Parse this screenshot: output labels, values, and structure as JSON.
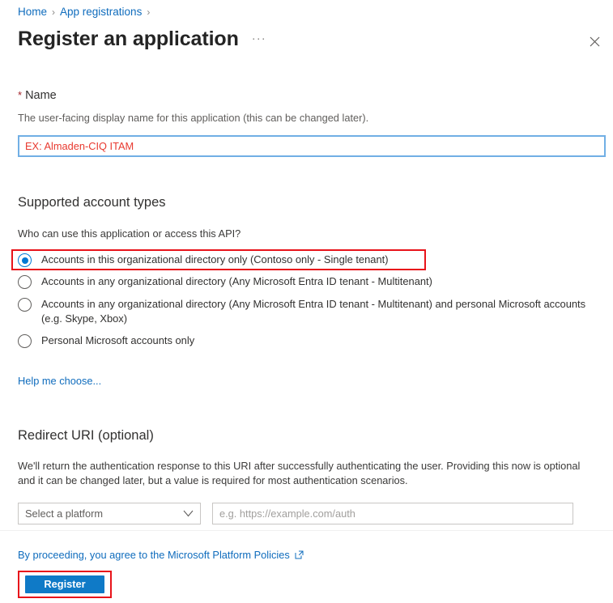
{
  "breadcrumb": {
    "items": [
      {
        "label": "Home"
      },
      {
        "label": "App registrations"
      }
    ],
    "separator": "›"
  },
  "header": {
    "title": "Register an application",
    "more_label": "···",
    "close_icon": "close-icon"
  },
  "name_field": {
    "label": "Name",
    "required_marker": "*",
    "description": "The user-facing display name for this application (this can be changed later).",
    "value": "EX: Almaden-CIQ ITAM",
    "placeholder": "EX: Almaden-CIQ ITAM"
  },
  "supported_account_types": {
    "heading": "Supported account types",
    "question": "Who can use this application or access this API?",
    "options": [
      {
        "label": "Accounts in this organizational directory only (Contoso only - Single tenant)",
        "selected": true,
        "highlighted": true
      },
      {
        "label": "Accounts in any organizational directory (Any Microsoft Entra ID tenant - Multitenant)",
        "selected": false,
        "highlighted": false
      },
      {
        "label": "Accounts in any organizational directory (Any Microsoft Entra ID tenant - Multitenant) and personal Microsoft accounts (e.g. Skype, Xbox)",
        "selected": false,
        "highlighted": false
      },
      {
        "label": "Personal Microsoft accounts only",
        "selected": false,
        "highlighted": false
      }
    ],
    "help_link": "Help me choose..."
  },
  "redirect_uri": {
    "heading": "Redirect URI (optional)",
    "description": "We'll return the authentication response to this URI after successfully authenticating the user. Providing this now is optional and it can be changed later, but a value is required for most authentication scenarios.",
    "platform_value": "Select a platform",
    "platform_chevron": "chevron-down-icon",
    "uri_value": "",
    "uri_placeholder": "e.g. https://example.com/auth"
  },
  "footer": {
    "policy_text": "By proceeding, you agree to the Microsoft Platform Policies",
    "policy_icon": "external-link-icon",
    "register_label": "Register"
  },
  "colors": {
    "link": "#0f6cbd",
    "accent_blue": "#0078d4",
    "button_blue": "#0f7ac7",
    "highlight_red": "#e8131a",
    "required_red": "#a4262c",
    "placeholder_red": "#e8392f",
    "focus_border": "#71afe5"
  }
}
